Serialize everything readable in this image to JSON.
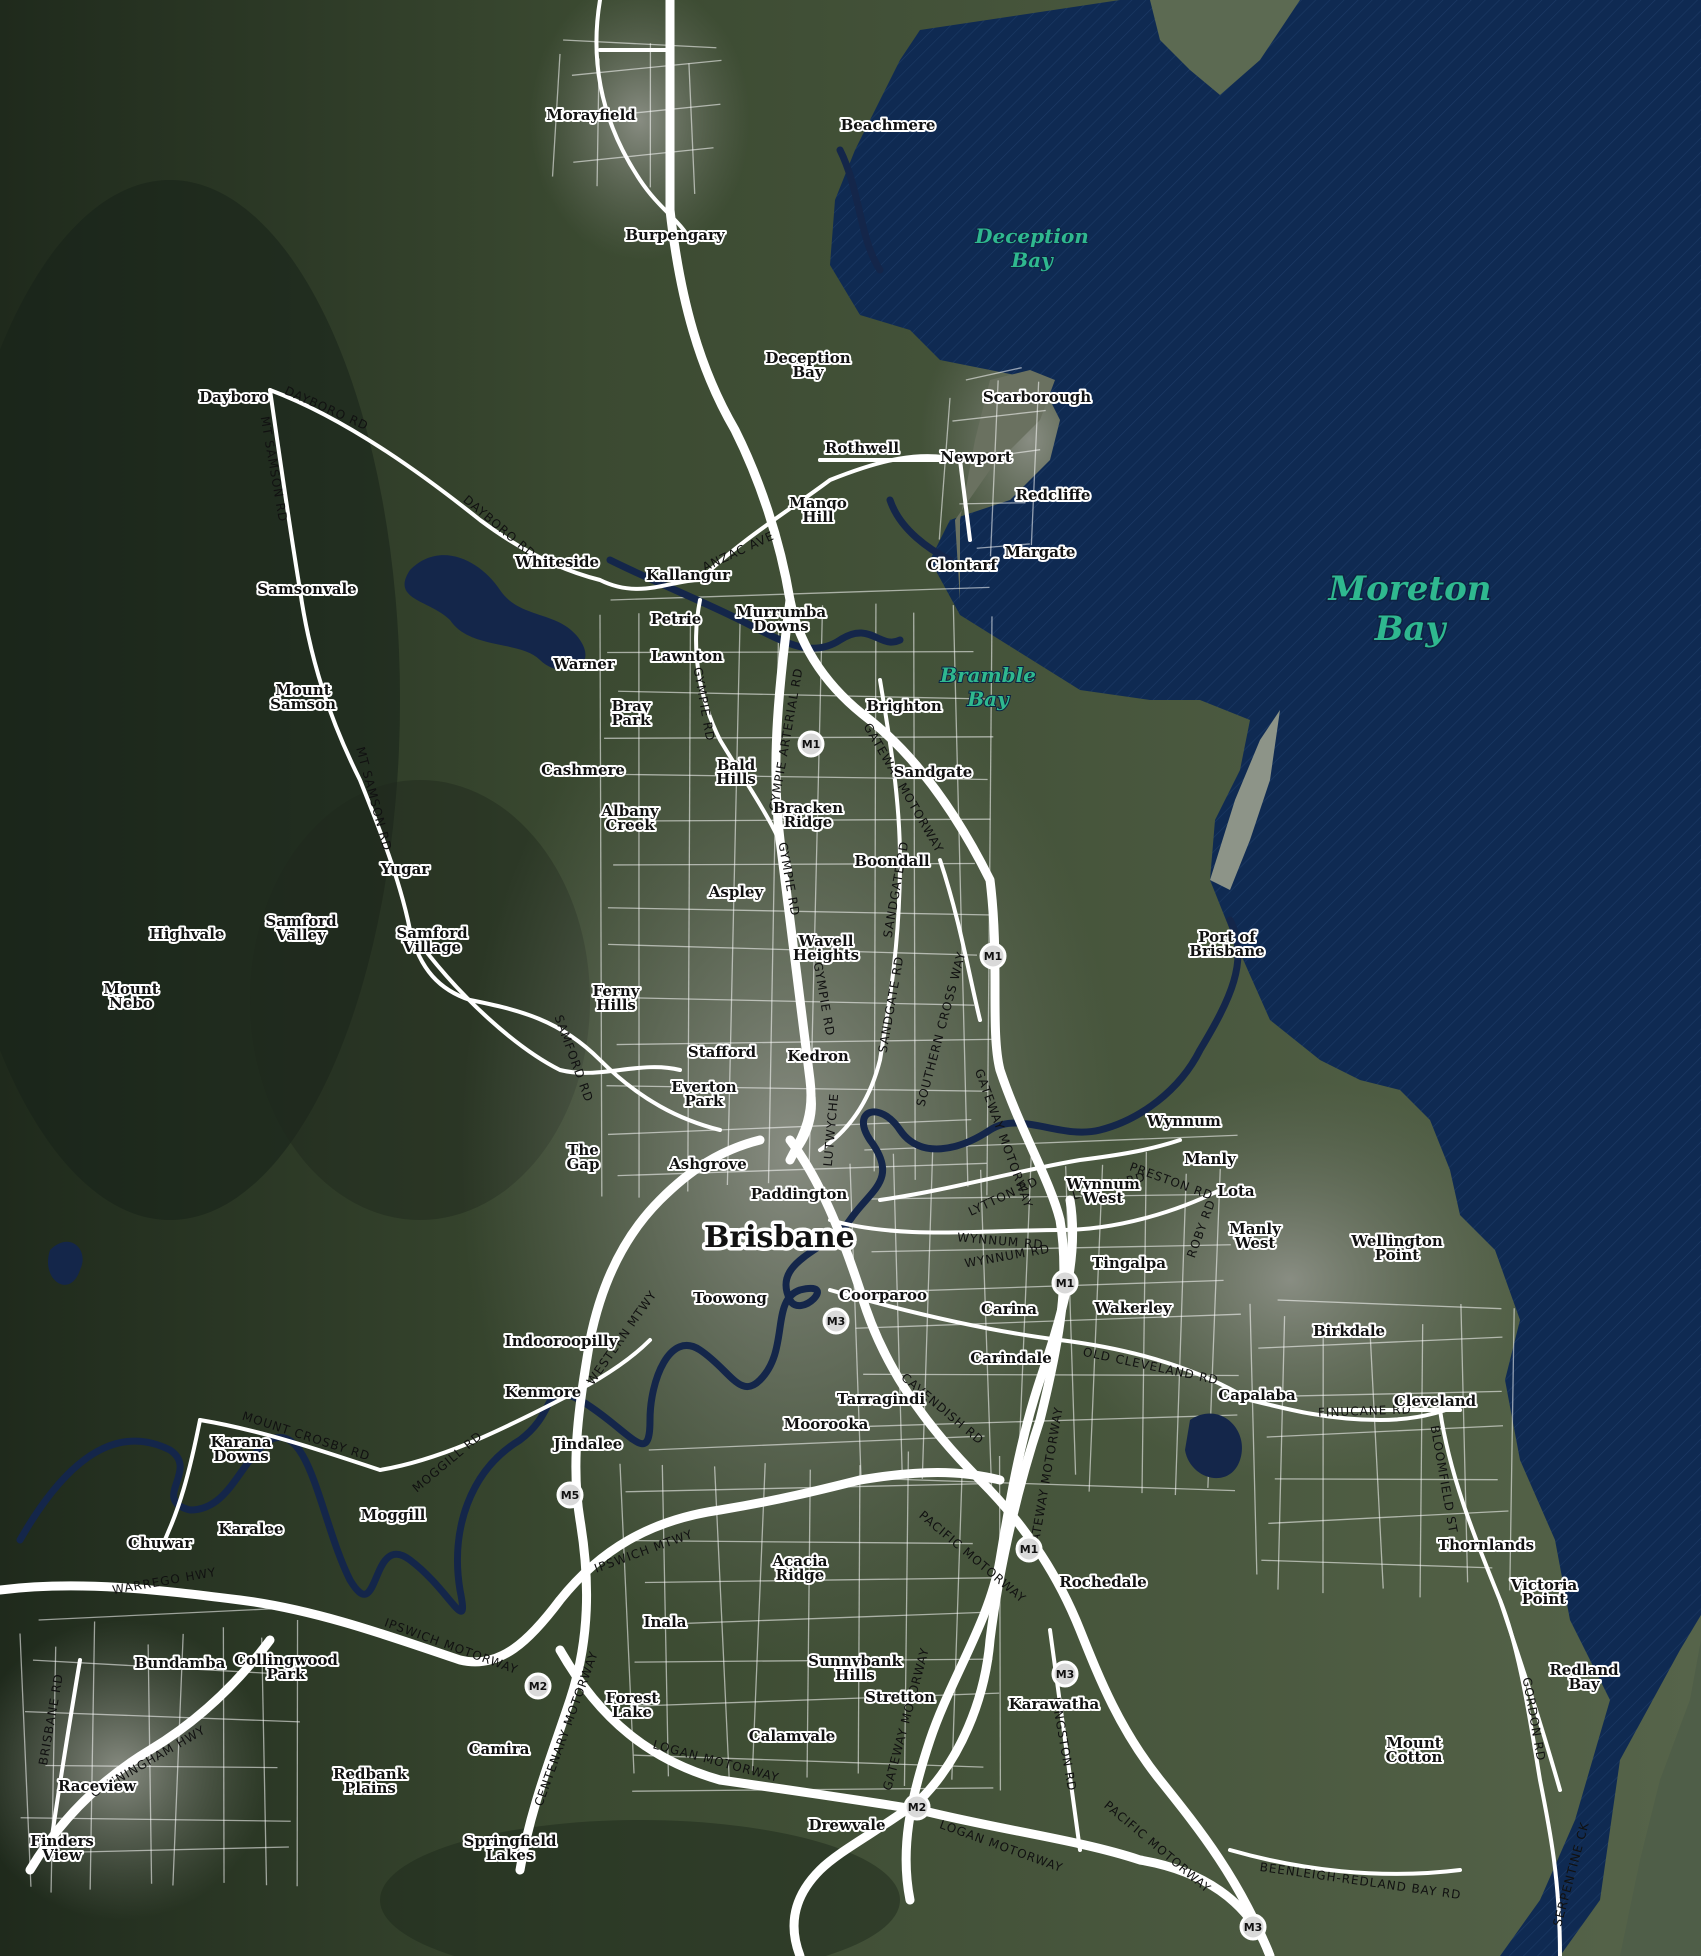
{
  "map": {
    "colors": {
      "water": "#0f2a52",
      "water_label": "#2fb88f",
      "land_dark": "#2e3a2a",
      "land_mid": "#4a5a3e",
      "urban": "#7f857c",
      "roads": "#ffffff"
    },
    "water_labels": [
      {
        "id": "moreton",
        "lines": [
          "Moreton",
          "Bay"
        ]
      },
      {
        "id": "deception",
        "lines": [
          "Deception",
          "Bay"
        ]
      },
      {
        "id": "bramble",
        "lines": [
          "Bramble",
          "Bay"
        ]
      }
    ],
    "city_label": "Brisbane",
    "places": [
      {
        "lines": [
          "Morayfield"
        ]
      },
      {
        "lines": [
          "Beachmere"
        ]
      },
      {
        "lines": [
          "Burpengary"
        ]
      },
      {
        "lines": [
          "Deception",
          "Bay"
        ]
      },
      {
        "lines": [
          "Scarborough"
        ]
      },
      {
        "lines": [
          "Dayboro"
        ]
      },
      {
        "lines": [
          "Rothwell"
        ]
      },
      {
        "lines": [
          "Newport"
        ]
      },
      {
        "lines": [
          "Redcliffe"
        ]
      },
      {
        "lines": [
          "Mango",
          "Hill"
        ]
      },
      {
        "lines": [
          "Margate"
        ]
      },
      {
        "lines": [
          "Clontarf"
        ]
      },
      {
        "lines": [
          "Whiteside"
        ]
      },
      {
        "lines": [
          "Kallangur"
        ]
      },
      {
        "lines": [
          "Samsonvale"
        ]
      },
      {
        "lines": [
          "Petrie"
        ]
      },
      {
        "lines": [
          "Murrumba",
          "Downs"
        ]
      },
      {
        "lines": [
          "Lawnton"
        ]
      },
      {
        "lines": [
          "Warner"
        ]
      },
      {
        "lines": [
          "Mount",
          "Samson"
        ]
      },
      {
        "lines": [
          "Brighton"
        ]
      },
      {
        "lines": [
          "Bray",
          "Park"
        ]
      },
      {
        "lines": [
          "Cashmere"
        ]
      },
      {
        "lines": [
          "Bald",
          "Hills"
        ]
      },
      {
        "lines": [
          "Sandgate"
        ]
      },
      {
        "lines": [
          "Albany",
          "Creek"
        ]
      },
      {
        "lines": [
          "Bracken",
          "Ridge"
        ]
      },
      {
        "lines": [
          "Boondall"
        ]
      },
      {
        "lines": [
          "Yugar"
        ]
      },
      {
        "lines": [
          "Aspley"
        ]
      },
      {
        "lines": [
          "Highvale"
        ]
      },
      {
        "lines": [
          "Samford",
          "Valley"
        ]
      },
      {
        "lines": [
          "Samford",
          "Village"
        ]
      },
      {
        "lines": [
          "Wavell",
          "Heights"
        ]
      },
      {
        "lines": [
          "Port of",
          "Brisbane"
        ]
      },
      {
        "lines": [
          "Mount",
          "Nebo"
        ]
      },
      {
        "lines": [
          "Ferny",
          "Hills"
        ]
      },
      {
        "lines": [
          "Stafford"
        ]
      },
      {
        "lines": [
          "Kedron"
        ]
      },
      {
        "lines": [
          "Everton",
          "Park"
        ]
      },
      {
        "lines": [
          "Wynnum"
        ]
      },
      {
        "lines": [
          "The",
          "Gap"
        ]
      },
      {
        "lines": [
          "Ashgrove"
        ]
      },
      {
        "lines": [
          "Manly"
        ]
      },
      {
        "lines": [
          "Wynnum",
          "West"
        ]
      },
      {
        "lines": [
          "Lota"
        ]
      },
      {
        "lines": [
          "Paddington"
        ]
      },
      {
        "lines": [
          "Manly",
          "West"
        ]
      },
      {
        "lines": [
          "Wellington",
          "Point"
        ]
      },
      {
        "lines": [
          "Tingalpa"
        ]
      },
      {
        "lines": [
          "Toowong"
        ]
      },
      {
        "lines": [
          "Coorparoo"
        ]
      },
      {
        "lines": [
          "Carina"
        ]
      },
      {
        "lines": [
          "Wakerley"
        ]
      },
      {
        "lines": [
          "Birkdale"
        ]
      },
      {
        "lines": [
          "Indooroopilly"
        ]
      },
      {
        "lines": [
          "Carindale"
        ]
      },
      {
        "lines": [
          "Kenmore"
        ]
      },
      {
        "lines": [
          "Capalaba"
        ]
      },
      {
        "lines": [
          "Tarragindi"
        ]
      },
      {
        "lines": [
          "Cleveland"
        ]
      },
      {
        "lines": [
          "Moorooka"
        ]
      },
      {
        "lines": [
          "Jindalee"
        ]
      },
      {
        "lines": [
          "Karana",
          "Downs"
        ]
      },
      {
        "lines": [
          "Karalee"
        ]
      },
      {
        "lines": [
          "Moggill"
        ]
      },
      {
        "lines": [
          "Chuwar"
        ]
      },
      {
        "lines": [
          "Thornlands"
        ]
      },
      {
        "lines": [
          "Acacia",
          "Ridge"
        ]
      },
      {
        "lines": [
          "Rochedale"
        ]
      },
      {
        "lines": [
          "Victoria",
          "Point"
        ]
      },
      {
        "lines": [
          "Inala"
        ]
      },
      {
        "lines": [
          "Bundamba"
        ]
      },
      {
        "lines": [
          "Collingwood",
          "Park"
        ]
      },
      {
        "lines": [
          "Sunnybank",
          "Hills"
        ]
      },
      {
        "lines": [
          "Redland",
          "Bay"
        ]
      },
      {
        "lines": [
          "Stretton"
        ]
      },
      {
        "lines": [
          "Karawatha"
        ]
      },
      {
        "lines": [
          "Forest",
          "Lake"
        ]
      },
      {
        "lines": [
          "Calamvale"
        ]
      },
      {
        "lines": [
          "Camira"
        ]
      },
      {
        "lines": [
          "Mount",
          "Cotton"
        ]
      },
      {
        "lines": [
          "Raceview"
        ]
      },
      {
        "lines": [
          "Redbank",
          "Plains"
        ]
      },
      {
        "lines": [
          "Drewvale"
        ]
      },
      {
        "lines": [
          "Finders",
          "View"
        ]
      },
      {
        "lines": [
          "Springfield",
          "Lakes"
        ]
      }
    ],
    "road_labels": [
      "DAYBORO RD",
      "MT SAMSON RD",
      "DAYBORO RD",
      "ANZAC AVE",
      "GYMPIE RD",
      "GYMPIE ARTERIAL RD",
      "GATEWAY MOTORWAY",
      "MT SAMSON RD",
      "GYMPIE RD",
      "SANDGATE RD",
      "GYMPIE RD",
      "SANDGATE RD",
      "SOUTHERN CROSS WAY",
      "SAMFORD RD",
      "LUTWYCHE",
      "GATEWAY MOTORWAY",
      "LYTTON RD",
      "PRESTON RD",
      "LYTTON RD",
      "WYNNUM RD",
      "WYNNUM RD",
      "ROBY RD",
      "WESTERN MTWY",
      "OLD CLEVELAND RD",
      "CAVENDISH RD",
      "MOUNT CROSBY RD",
      "MOGGILL RD",
      "FINUCANE RD",
      "BLOOMFIELD ST",
      "GATEWAY MOTORWAY",
      "PACIFIC MOTORWAY",
      "IPSWICH MTWY",
      "WARREGO HWY",
      "IPSWICH MOTORWAY",
      "GORDON RD",
      "CENTENARY MOTORWAY",
      "GATEWAY MOTORWAY",
      "BRISBANE RD",
      "CUNNINGHAM HWY",
      "LOGAN MOTORWAY",
      "KINGSTON RD",
      "PACIFIC MOTORWAY",
      "LOGAN MOTORWAY",
      "BEENLEIGH-REDLAND BAY RD",
      "SERPENTINE CK"
    ],
    "shields": [
      "M1",
      "M1",
      "M1",
      "M3",
      "M5",
      "M1",
      "M2",
      "M3",
      "M2",
      "M3"
    ]
  }
}
